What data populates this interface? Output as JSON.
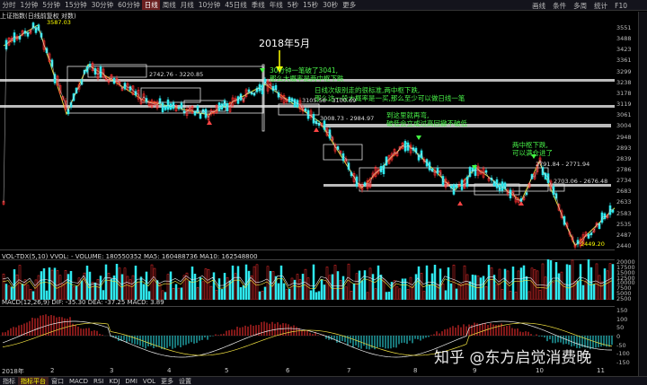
{
  "colors": {
    "up": "#ff3030",
    "down": "#2ee8ee",
    "ma": "#e8e8e8",
    "ann": "#48f048",
    "zone": "#d0d0d0"
  },
  "toolbar": {
    "timeframes": [
      "分时",
      "1分钟",
      "5分钟",
      "15分钟",
      "30分钟",
      "60分钟",
      "日线",
      "周线",
      "月线",
      "10分钟",
      "45日线",
      "季线",
      "年线",
      "5秒",
      "15秒",
      "30秒",
      "更多"
    ],
    "right": [
      "画线",
      "条件",
      "多周",
      "统计",
      "F10"
    ]
  },
  "header": {
    "instrument": "上证指数(日线前复权 对数)"
  },
  "chart": {
    "headline": "2018年5月",
    "top_value": "3587.03",
    "low_value": "2449.20",
    "annotations": [
      "30分钟一笔破了3041,",
      "那么大概率是两中枢下跌",
      "日线次级别走的很标准,两中枢下跌,",
      "那么这一段大概率是一买,那么至少可以做日线一笔",
      "到这里就再弯,",
      "破低会立或过高回撤不破低",
      "两中枢下跌,",
      "可以满仓进了"
    ],
    "price_tags": [
      "2742.76 - 3220.85",
      "3105.58 - 3100.69",
      "3008.73 - 2984.97",
      "2791.84 - 2771.94",
      "2703.06 - 2676.48"
    ],
    "axis": [
      "3551",
      "3488",
      "3423",
      "3361",
      "3299",
      "3238",
      "3178",
      "3119",
      "3061",
      "3004",
      "2948",
      "2893",
      "2839",
      "2786",
      "2734",
      "2683",
      "2633",
      "2583",
      "2535",
      "2487",
      "2440"
    ],
    "months": [
      "2018年",
      "2",
      "3",
      "4",
      "5",
      "6",
      "7",
      "8",
      "9",
      "10",
      "11"
    ]
  },
  "vol": {
    "label": "VOL-TDX(5,10) VVOL: - VOLUME: 180550352 MA5: 160488736 MA10: 162548800",
    "axis": [
      "20000",
      "17500",
      "15000",
      "12500",
      "10000",
      "7500",
      "5000",
      "2500"
    ]
  },
  "macd": {
    "label": "MACD(12,26,9) DIF: -35.30 DEA: -37.25 MACD: 3.89",
    "axis": [
      "150",
      "100",
      "50",
      "0",
      "-50",
      "-100",
      "-150"
    ]
  },
  "bottom": [
    "指标",
    "指标平台",
    "窗口",
    "MACD",
    "RSI",
    "KDJ",
    "DMI",
    "VOL",
    "更多",
    "设置"
  ],
  "watermark": "知乎 @东方启觉消费晚"
}
